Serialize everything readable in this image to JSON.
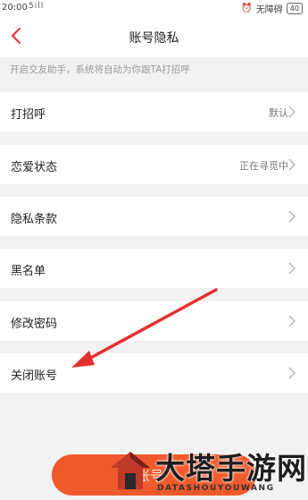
{
  "status_bar": {
    "time": "20:00",
    "signal_text": "5ill",
    "accessibility_label": "无障碍",
    "battery": "40"
  },
  "header": {
    "title": "账号隐私",
    "back_icon": "chevron-left-icon",
    "accent_color": "#e8373a"
  },
  "hint": "开启交友助手，系统将自动为你跟TA打招呼",
  "settings": {
    "items": [
      {
        "label": "打招呼",
        "value": "默认"
      },
      {
        "label": "恋爱状态",
        "value": "正在寻觅中"
      },
      {
        "label": "隐私条款",
        "value": ""
      },
      {
        "label": "黑名单",
        "value": ""
      },
      {
        "label": "修改密码",
        "value": ""
      },
      {
        "label": "关闭账号",
        "value": ""
      }
    ]
  },
  "bottom_button": {
    "label": "账号",
    "color": "#ef5a2c"
  },
  "annotation": {
    "arrow_color": "#e3302f"
  },
  "watermark": {
    "cn": "大塔手游网",
    "en": "DATASHOUYOUWANG"
  }
}
